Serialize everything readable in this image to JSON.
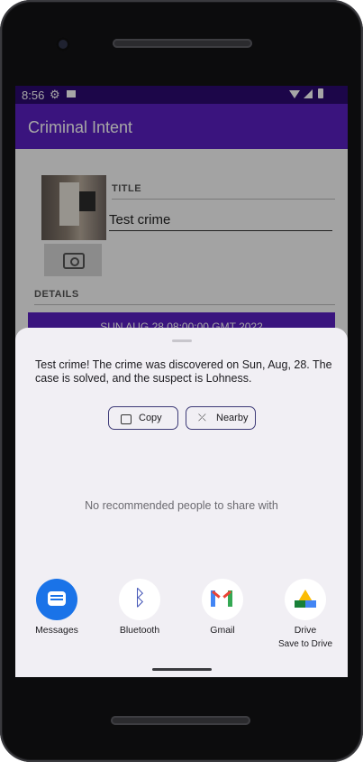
{
  "status_bar": {
    "time": "8:56"
  },
  "app_bar": {
    "title": "Criminal Intent"
  },
  "crime_form": {
    "title_label": "TITLE",
    "title_value": "Test crime",
    "details_label": "DETAILS",
    "date_button": "SUN AUG 28 08:00:00 GMT 2022"
  },
  "share_sheet": {
    "text": "Test crime! The crime was discovered on Sun, Aug, 28. The case is solved, and the suspect is Lohness.",
    "copy_label": "Copy",
    "nearby_label": "Nearby",
    "no_recommendations": "No recommended people to share with",
    "apps": [
      {
        "name": "Messages",
        "icon": "messages-icon"
      },
      {
        "name": "Bluetooth",
        "icon": "bluetooth-icon"
      },
      {
        "name": "Gmail",
        "icon": "gmail-icon"
      },
      {
        "name": "Drive",
        "subtitle": "Save to Drive",
        "icon": "drive-icon"
      }
    ]
  },
  "icons": {
    "status": [
      "gear-icon",
      "screenshot-icon",
      "wifi-icon",
      "signal-icon",
      "battery-icon"
    ],
    "camera_button": "camera-icon"
  },
  "colors": {
    "status_bar": "#2c0a70",
    "app_bar": "#5a1fc2",
    "sheet_background": "#f1eff4",
    "button_outline": "#3d3a77"
  }
}
